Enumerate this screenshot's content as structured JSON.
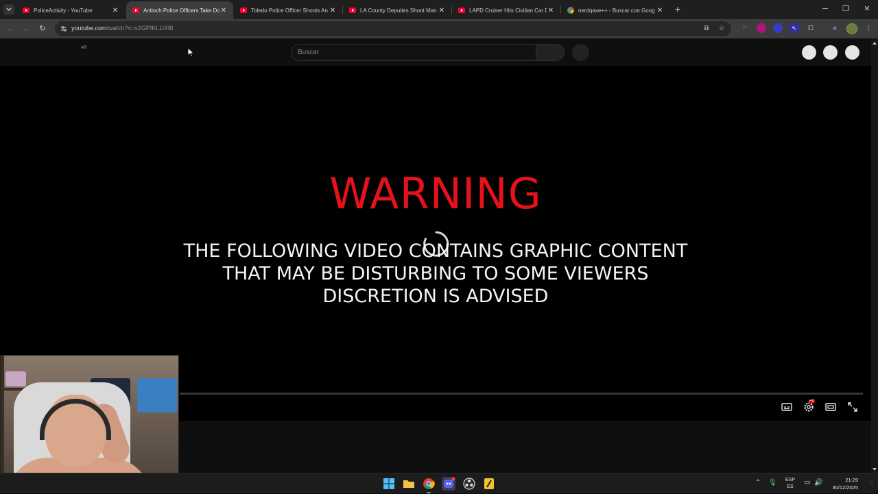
{
  "browser": {
    "tabs": [
      {
        "title": "PoliceActivity - YouTube",
        "favicon": "youtube-icon",
        "active": false
      },
      {
        "title": "Antioch Police Officers Take Do",
        "favicon": "youtube-icon",
        "active": true
      },
      {
        "title": "Toledo Police Officer Shoots An",
        "favicon": "youtube-icon",
        "active": false
      },
      {
        "title": "LA County Deputies Shoot Man",
        "favicon": "youtube-icon",
        "active": false
      },
      {
        "title": "LAPD Cruiser Hits Civilian Car D",
        "favicon": "youtube-icon",
        "active": false
      },
      {
        "title": "nerdqaxe++ - Buscar con Goog",
        "favicon": "google-icon",
        "active": false
      }
    ],
    "close_glyph": "✕",
    "new_tab_glyph": "+",
    "url": {
      "host": "youtube.com",
      "path": "/watch?v=s2GPfKLUX8I"
    }
  },
  "youtube": {
    "country_code": "AR",
    "search_placeholder": "Buscar"
  },
  "video": {
    "warning_title": "WARNING",
    "warning_lines": [
      "THE FOLLOWING VIDEO CONTAINS GRAPHIC CONTENT",
      "THAT MAY BE DISTURBING TO SOME VIEWERS",
      "DISCRETION IS ADVISED"
    ],
    "quality_badge": "HD",
    "progress": 0
  },
  "taskbar": {
    "language": [
      "ESP",
      "ES"
    ],
    "time": "21:29",
    "date": "30/12/2025"
  },
  "colors": {
    "warning_red": "#e5121a",
    "youtube_red": "#ff0033",
    "chrome_dark": "#1f1f1f"
  }
}
